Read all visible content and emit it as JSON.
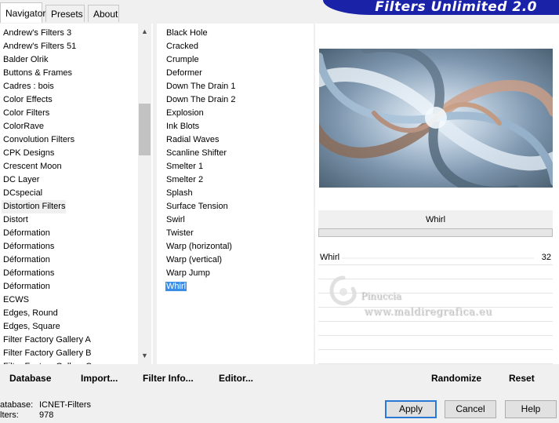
{
  "tabs": [
    {
      "label": "Navigator",
      "active": true
    },
    {
      "label": "Presets",
      "active": false
    },
    {
      "label": "About",
      "active": false
    }
  ],
  "banner": {
    "title": "Filters Unlimited 2.0",
    "color": "#1a22a8"
  },
  "categories": [
    "Andrew's Filters 3",
    "Andrew's Filters 51",
    "Balder Olrik",
    "Buttons & Frames",
    "Cadres : bois",
    "Color Effects",
    "Color Filters",
    "ColorRave",
    "Convolution Filters",
    "CPK Designs",
    "Crescent Moon",
    "DC Layer",
    "DCspecial",
    "Distortion Filters",
    "Distort",
    "Déformation",
    "Déformations",
    "Déformation",
    "Déformations",
    "Déformation",
    "ECWS",
    "Edges, Round",
    "Edges, Square",
    "Filter Factory Gallery A",
    "Filter Factory Gallery B",
    "Filter Factory Gallery C"
  ],
  "selected_category": "Distortion Filters",
  "filters": [
    "Black Hole",
    "Cracked",
    "Crumple",
    "Deformer",
    "Down The Drain 1",
    "Down The Drain 2",
    "Explosion",
    "Ink Blots",
    "Radial Waves",
    "Scanline Shifter",
    "Smelter 1",
    "Smelter 2",
    "Splash",
    "Surface Tension",
    "Swirl",
    "Twister",
    "Warp (horizontal)",
    "Warp (vertical)",
    "Warp Jump",
    "Whirl"
  ],
  "selected_filter": "Whirl",
  "preview": {
    "filter_name": "Whirl"
  },
  "params": [
    {
      "label": "Whirl",
      "value": "32"
    }
  ],
  "watermark": {
    "line1": "Pinuccia",
    "line2": "www.maldiregrafica.eu"
  },
  "toolbar": {
    "database": "Database",
    "import": "Import...",
    "filter_info": "Filter Info...",
    "editor": "Editor...",
    "randomize": "Randomize",
    "reset": "Reset"
  },
  "footer": {
    "database_label": "atabase:",
    "database_value": "ICNET-Filters",
    "filters_label": "lters:",
    "filters_value": "978"
  },
  "buttons": {
    "apply": "Apply",
    "cancel": "Cancel",
    "help": "Help"
  },
  "accent_color": "#3b8ee8"
}
